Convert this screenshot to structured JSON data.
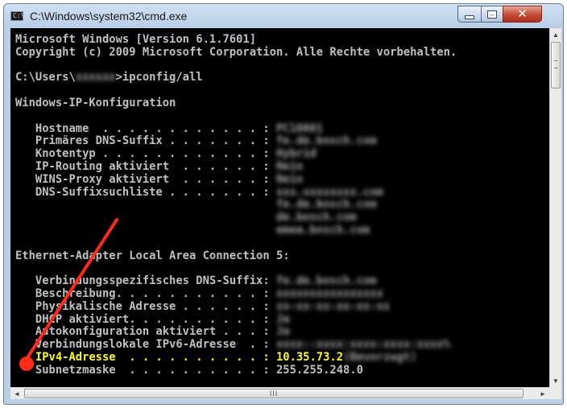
{
  "window": {
    "title": "C:\\Windows\\system32\\cmd.exe",
    "icon_label": "C:\\",
    "minimize_icon": "minimize-icon",
    "maximize_icon": "maximize-icon",
    "close_icon": "close-icon"
  },
  "console": {
    "lines": [
      {
        "parts": [
          {
            "text": "Microsoft Windows [Version 6.1.7601]"
          }
        ]
      },
      {
        "parts": [
          {
            "text": "Copyright (c) 2009 Microsoft Corporation. Alle Rechte vorbehalten."
          }
        ]
      },
      {
        "parts": [
          {
            "text": ""
          }
        ]
      },
      {
        "parts": [
          {
            "text": "C:\\Users\\"
          },
          {
            "text": "xxxxxx",
            "blur": true
          },
          {
            "text": ">ipconfig/all"
          }
        ]
      },
      {
        "parts": [
          {
            "text": ""
          }
        ]
      },
      {
        "parts": [
          {
            "text": "Windows-IP-Konfiguration"
          }
        ]
      },
      {
        "parts": [
          {
            "text": ""
          }
        ]
      },
      {
        "parts": [
          {
            "text": "   Hostname  . . . . . . . . . . . . : "
          },
          {
            "text": "PC10001",
            "blur": true
          }
        ]
      },
      {
        "parts": [
          {
            "text": "   Primäres DNS-Suffix . . . . . . . : "
          },
          {
            "text": "fe.de.bosch.com",
            "blur": true
          }
        ]
      },
      {
        "parts": [
          {
            "text": "   Knotentyp . . . . . . . . . . . . : "
          },
          {
            "text": "Hybrid",
            "blur": true
          }
        ]
      },
      {
        "parts": [
          {
            "text": "   IP-Routing aktiviert  . . . . . . : "
          },
          {
            "text": "Nein",
            "blur": true
          }
        ]
      },
      {
        "parts": [
          {
            "text": "   WINS-Proxy aktiviert  . . . . . . : "
          },
          {
            "text": "Nein",
            "blur": true
          }
        ]
      },
      {
        "parts": [
          {
            "text": "   DNS-Suffixsuchliste . . . . . . . : "
          },
          {
            "text": "xxx.xxxxxxxx.com",
            "blur": true
          }
        ]
      },
      {
        "parts": [
          {
            "text": "                                       "
          },
          {
            "text": "fe.de.bosch.com",
            "blur": true
          }
        ]
      },
      {
        "parts": [
          {
            "text": "                                       "
          },
          {
            "text": "de.bosch.com",
            "blur": true
          }
        ]
      },
      {
        "parts": [
          {
            "text": "                                       "
          },
          {
            "text": "emea.bosch.com",
            "blur": true
          }
        ]
      },
      {
        "parts": [
          {
            "text": ""
          }
        ]
      },
      {
        "parts": [
          {
            "text": "Ethernet-Adapter Local Area Connection 5:"
          }
        ]
      },
      {
        "parts": [
          {
            "text": ""
          }
        ]
      },
      {
        "parts": [
          {
            "text": "   Verbindungsspezifisches DNS-Suffix: "
          },
          {
            "text": "fe.de.bosch.com",
            "blur": true
          }
        ]
      },
      {
        "parts": [
          {
            "text": "   Beschreibung. . . . . . . . . . . : "
          },
          {
            "text": "xxxxxxxxxxxxxxxx",
            "blur": true
          }
        ]
      },
      {
        "parts": [
          {
            "text": "   Physikalische Adresse . . . . . . : "
          },
          {
            "text": "xx-xx-xx-xx-xx-xx",
            "blur": true
          }
        ]
      },
      {
        "parts": [
          {
            "text": "   DHCP aktiviert. . . . . . . . . . : "
          },
          {
            "text": "Ja",
            "blur": true
          }
        ]
      },
      {
        "parts": [
          {
            "text": "   Autokonfiguration aktiviert . . . : "
          },
          {
            "text": "Ja",
            "blur": true
          }
        ]
      },
      {
        "parts": [
          {
            "text": "   Verbindungslokale IPv6-Adresse  . : "
          },
          {
            "text": "xxxx::xxxx:xxxx:xxxx:xxxx%",
            "blur": true
          }
        ]
      },
      {
        "highlight": true,
        "parts": [
          {
            "text": "   IPv4-Adresse  . . . . . . . . . . : 10.35.73.2"
          },
          {
            "text": "(Bevorzugt)",
            "blur": true
          }
        ]
      },
      {
        "parts": [
          {
            "text": "   Subnetzmaske  . . . . . . . . . . : 255.255.248.0"
          }
        ]
      }
    ]
  },
  "scrollbars": {
    "up_arrow": "▲",
    "down_arrow": "▼",
    "left_arrow": "◄",
    "right_arrow": "►",
    "h_thumb_grip": "III"
  },
  "annotation": {
    "color": "#ff2a1a",
    "shape": "arrow-icon"
  }
}
